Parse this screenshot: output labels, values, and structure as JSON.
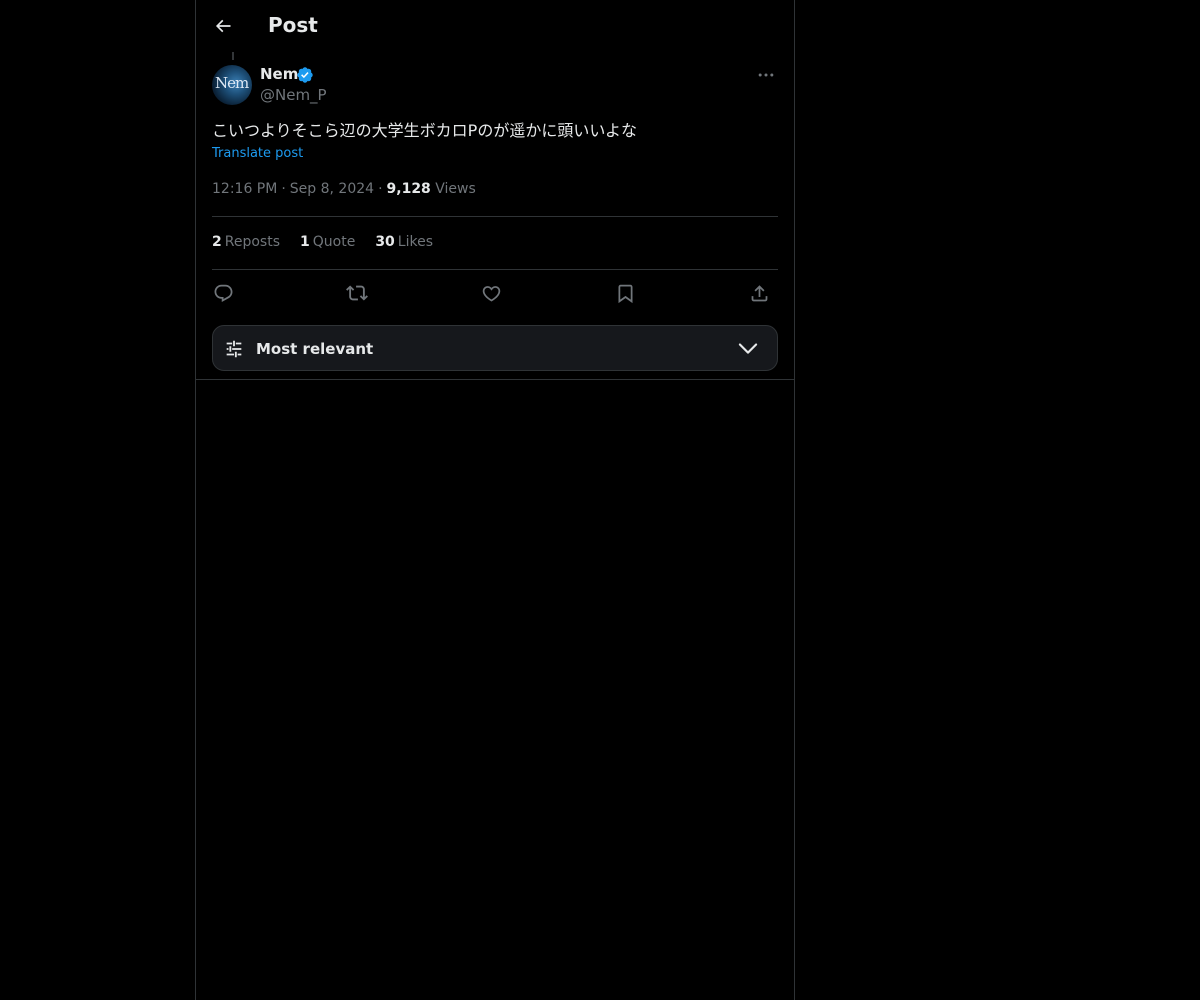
{
  "header": {
    "title": "Post",
    "back_icon": "arrow-left-icon"
  },
  "author": {
    "display_name": "Nem",
    "handle": "@Nem_P",
    "verified": true,
    "verified_color": "#1d9bf0",
    "avatar_text": "Nem"
  },
  "post": {
    "text": "こいつよりそこら辺の大学生ボカロPのが遥かに頭いいよな",
    "translate_label": "Translate post",
    "time": "12:16 PM",
    "date": "Sep 8, 2024",
    "views_count": "9,128",
    "views_label": "Views",
    "separator": "·"
  },
  "stats": {
    "reposts_count": "2",
    "reposts_label": "Reposts",
    "quotes_count": "1",
    "quotes_label": "Quote",
    "likes_count": "30",
    "likes_label": "Likes"
  },
  "actions": [
    "reply-icon",
    "repost-icon",
    "like-icon",
    "bookmark-icon",
    "share-icon"
  ],
  "sort": {
    "label": "Most relevant",
    "icon": "sliders-icon",
    "chevron": "chevron-down-icon"
  },
  "colors": {
    "background": "#000000",
    "text": "#e7e9ea",
    "muted": "#71767b",
    "accent": "#1d9bf0",
    "border": "#2f3336"
  }
}
